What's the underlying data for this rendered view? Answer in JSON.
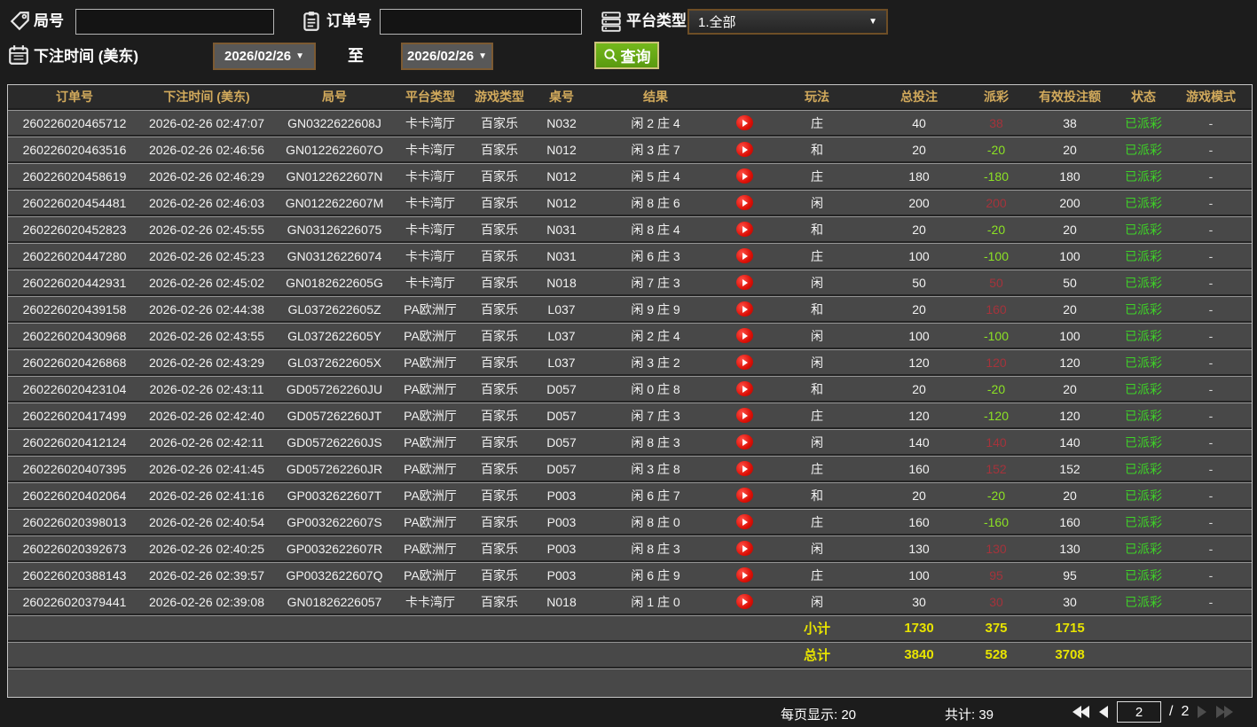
{
  "filters": {
    "game_no_label": "局号",
    "order_no_label": "订单号",
    "platform_label": "平台类型",
    "platform_value": "1.全部",
    "bet_time_label": "下注时间 (美东)",
    "date_from": "2026/02/26",
    "date_to": "2026/02/26",
    "to_label": "至",
    "query_label": "查询"
  },
  "icons": {
    "game_no": "tag-icon",
    "order_no": "clipboard-icon",
    "platform": "server-icon",
    "bet_time": "calendar-icon",
    "query": "magnifier-icon",
    "result_replay": "play-icon",
    "pager": [
      "first-page-icon",
      "prev-page-icon",
      "next-page-icon",
      "last-page-icon"
    ]
  },
  "colors": {
    "header_text": "#d2aa5c",
    "row_bg": "#484848",
    "win_red": "#a5333b",
    "loss_green": "#8ce224",
    "status_green": "#3ed227",
    "summary_yellow": "#e8e400",
    "query_button_green": "#64a813"
  },
  "table": {
    "headers": [
      "订单号",
      "下注时间 (美东)",
      "局号",
      "平台类型",
      "游戏类型",
      "桌号",
      "结果",
      "",
      "玩法",
      "总投注",
      "派彩",
      "有效投注额",
      "状态",
      "游戏模式"
    ],
    "rows": [
      {
        "order": "260226020465712",
        "time": "2026-02-26 02:47:07",
        "game_no": "GN0322622608J",
        "platform": "卡卡湾厅",
        "game_type": "百家乐",
        "table_no": "N032",
        "result": "闲 2 庄 4",
        "bet_type": "庄",
        "total_bet": "40",
        "payout": "38",
        "valid_bet": "38",
        "status": "已派彩",
        "mode": "-"
      },
      {
        "order": "260226020463516",
        "time": "2026-02-26 02:46:56",
        "game_no": "GN0122622607O",
        "platform": "卡卡湾厅",
        "game_type": "百家乐",
        "table_no": "N012",
        "result": "闲 3 庄 7",
        "bet_type": "和",
        "total_bet": "20",
        "payout": "-20",
        "valid_bet": "20",
        "status": "已派彩",
        "mode": "-"
      },
      {
        "order": "260226020458619",
        "time": "2026-02-26 02:46:29",
        "game_no": "GN0122622607N",
        "platform": "卡卡湾厅",
        "game_type": "百家乐",
        "table_no": "N012",
        "result": "闲 5 庄 4",
        "bet_type": "庄",
        "total_bet": "180",
        "payout": "-180",
        "valid_bet": "180",
        "status": "已派彩",
        "mode": "-"
      },
      {
        "order": "260226020454481",
        "time": "2026-02-26 02:46:03",
        "game_no": "GN0122622607M",
        "platform": "卡卡湾厅",
        "game_type": "百家乐",
        "table_no": "N012",
        "result": "闲 8 庄 6",
        "bet_type": "闲",
        "total_bet": "200",
        "payout": "200",
        "valid_bet": "200",
        "status": "已派彩",
        "mode": "-"
      },
      {
        "order": "260226020452823",
        "time": "2026-02-26 02:45:55",
        "game_no": "GN03126226075",
        "platform": "卡卡湾厅",
        "game_type": "百家乐",
        "table_no": "N031",
        "result": "闲 8 庄 4",
        "bet_type": "和",
        "total_bet": "20",
        "payout": "-20",
        "valid_bet": "20",
        "status": "已派彩",
        "mode": "-"
      },
      {
        "order": "260226020447280",
        "time": "2026-02-26 02:45:23",
        "game_no": "GN03126226074",
        "platform": "卡卡湾厅",
        "game_type": "百家乐",
        "table_no": "N031",
        "result": "闲 6 庄 3",
        "bet_type": "庄",
        "total_bet": "100",
        "payout": "-100",
        "valid_bet": "100",
        "status": "已派彩",
        "mode": "-"
      },
      {
        "order": "260226020442931",
        "time": "2026-02-26 02:45:02",
        "game_no": "GN0182622605G",
        "platform": "卡卡湾厅",
        "game_type": "百家乐",
        "table_no": "N018",
        "result": "闲 7 庄 3",
        "bet_type": "闲",
        "total_bet": "50",
        "payout": "50",
        "valid_bet": "50",
        "status": "已派彩",
        "mode": "-"
      },
      {
        "order": "260226020439158",
        "time": "2026-02-26 02:44:38",
        "game_no": "GL0372622605Z",
        "platform": "PA欧洲厅",
        "game_type": "百家乐",
        "table_no": "L037",
        "result": "闲 9 庄 9",
        "bet_type": "和",
        "total_bet": "20",
        "payout": "160",
        "valid_bet": "20",
        "status": "已派彩",
        "mode": "-"
      },
      {
        "order": "260226020430968",
        "time": "2026-02-26 02:43:55",
        "game_no": "GL0372622605Y",
        "platform": "PA欧洲厅",
        "game_type": "百家乐",
        "table_no": "L037",
        "result": "闲 2 庄 4",
        "bet_type": "闲",
        "total_bet": "100",
        "payout": "-100",
        "valid_bet": "100",
        "status": "已派彩",
        "mode": "-"
      },
      {
        "order": "260226020426868",
        "time": "2026-02-26 02:43:29",
        "game_no": "GL0372622605X",
        "platform": "PA欧洲厅",
        "game_type": "百家乐",
        "table_no": "L037",
        "result": "闲 3 庄 2",
        "bet_type": "闲",
        "total_bet": "120",
        "payout": "120",
        "valid_bet": "120",
        "status": "已派彩",
        "mode": "-"
      },
      {
        "order": "260226020423104",
        "time": "2026-02-26 02:43:11",
        "game_no": "GD057262260JU",
        "platform": "PA欧洲厅",
        "game_type": "百家乐",
        "table_no": "D057",
        "result": "闲 0 庄 8",
        "bet_type": "和",
        "total_bet": "20",
        "payout": "-20",
        "valid_bet": "20",
        "status": "已派彩",
        "mode": "-"
      },
      {
        "order": "260226020417499",
        "time": "2026-02-26 02:42:40",
        "game_no": "GD057262260JT",
        "platform": "PA欧洲厅",
        "game_type": "百家乐",
        "table_no": "D057",
        "result": "闲 7 庄 3",
        "bet_type": "庄",
        "total_bet": "120",
        "payout": "-120",
        "valid_bet": "120",
        "status": "已派彩",
        "mode": "-"
      },
      {
        "order": "260226020412124",
        "time": "2026-02-26 02:42:11",
        "game_no": "GD057262260JS",
        "platform": "PA欧洲厅",
        "game_type": "百家乐",
        "table_no": "D057",
        "result": "闲 8 庄 3",
        "bet_type": "闲",
        "total_bet": "140",
        "payout": "140",
        "valid_bet": "140",
        "status": "已派彩",
        "mode": "-"
      },
      {
        "order": "260226020407395",
        "time": "2026-02-26 02:41:45",
        "game_no": "GD057262260JR",
        "platform": "PA欧洲厅",
        "game_type": "百家乐",
        "table_no": "D057",
        "result": "闲 3 庄 8",
        "bet_type": "庄",
        "total_bet": "160",
        "payout": "152",
        "valid_bet": "152",
        "status": "已派彩",
        "mode": "-"
      },
      {
        "order": "260226020402064",
        "time": "2026-02-26 02:41:16",
        "game_no": "GP0032622607T",
        "platform": "PA欧洲厅",
        "game_type": "百家乐",
        "table_no": "P003",
        "result": "闲 6 庄 7",
        "bet_type": "和",
        "total_bet": "20",
        "payout": "-20",
        "valid_bet": "20",
        "status": "已派彩",
        "mode": "-"
      },
      {
        "order": "260226020398013",
        "time": "2026-02-26 02:40:54",
        "game_no": "GP0032622607S",
        "platform": "PA欧洲厅",
        "game_type": "百家乐",
        "table_no": "P003",
        "result": "闲 8 庄 0",
        "bet_type": "庄",
        "total_bet": "160",
        "payout": "-160",
        "valid_bet": "160",
        "status": "已派彩",
        "mode": "-"
      },
      {
        "order": "260226020392673",
        "time": "2026-02-26 02:40:25",
        "game_no": "GP0032622607R",
        "platform": "PA欧洲厅",
        "game_type": "百家乐",
        "table_no": "P003",
        "result": "闲 8 庄 3",
        "bet_type": "闲",
        "total_bet": "130",
        "payout": "130",
        "valid_bet": "130",
        "status": "已派彩",
        "mode": "-"
      },
      {
        "order": "260226020388143",
        "time": "2026-02-26 02:39:57",
        "game_no": "GP0032622607Q",
        "platform": "PA欧洲厅",
        "game_type": "百家乐",
        "table_no": "P003",
        "result": "闲 6 庄 9",
        "bet_type": "庄",
        "total_bet": "100",
        "payout": "95",
        "valid_bet": "95",
        "status": "已派彩",
        "mode": "-"
      },
      {
        "order": "260226020379441",
        "time": "2026-02-26 02:39:08",
        "game_no": "GN01826226057",
        "platform": "卡卡湾厅",
        "game_type": "百家乐",
        "table_no": "N018",
        "result": "闲 1 庄 0",
        "bet_type": "闲",
        "total_bet": "30",
        "payout": "30",
        "valid_bet": "30",
        "status": "已派彩",
        "mode": "-"
      }
    ],
    "subtotal": {
      "label": "小计",
      "total_bet": "1730",
      "payout": "375",
      "valid_bet": "1715"
    },
    "total": {
      "label": "总计",
      "total_bet": "3840",
      "payout": "528",
      "valid_bet": "3708"
    }
  },
  "footer": {
    "per_page_label": "每页显示:",
    "per_page_value": "20",
    "total_count_label": "共计:",
    "total_count_value": "39",
    "page_value": "2",
    "page_separator": "/",
    "page_total": "2"
  }
}
